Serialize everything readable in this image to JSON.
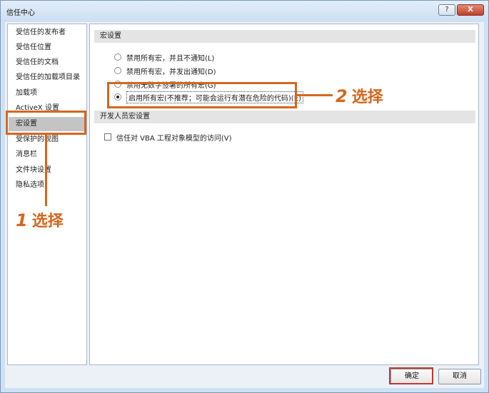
{
  "window": {
    "title": "信任中心",
    "help_label": "?",
    "close_label": "X"
  },
  "sidebar": {
    "items": [
      {
        "label": "受信任的发布者"
      },
      {
        "label": "受信任位置"
      },
      {
        "label": "受信任的文档"
      },
      {
        "label": "受信任的加载项目录"
      },
      {
        "label": "加载项"
      },
      {
        "label": "ActiveX 设置"
      },
      {
        "label": "宏设置"
      },
      {
        "label": "受保护的视图"
      },
      {
        "label": "消息栏"
      },
      {
        "label": "文件块设置"
      },
      {
        "label": "隐私选项"
      }
    ],
    "selected_index": 6
  },
  "content": {
    "macro_section_title": "宏设置",
    "radio_options": [
      {
        "label": "禁用所有宏，并且不通知(L)",
        "checked": false
      },
      {
        "label": "禁用所有宏，并发出通知(D)",
        "checked": false
      },
      {
        "label": "禁用无数字签署的所有宏(G)",
        "checked": false
      },
      {
        "label": "启用所有宏(不推荐；可能会运行有潜在危险的代码)(E)",
        "checked": true
      }
    ],
    "dev_section_title": "开发人员宏设置",
    "vba_checkbox_label": "信任对 VBA 工程对象模型的访问(V)",
    "vba_checked": false
  },
  "buttons": {
    "ok_label": "确定",
    "cancel_label": "取消"
  },
  "annotations": {
    "step1_number": "1",
    "step1_text": "选择",
    "step2_number": "2",
    "step2_text": "选择",
    "color": "#d5661e"
  }
}
